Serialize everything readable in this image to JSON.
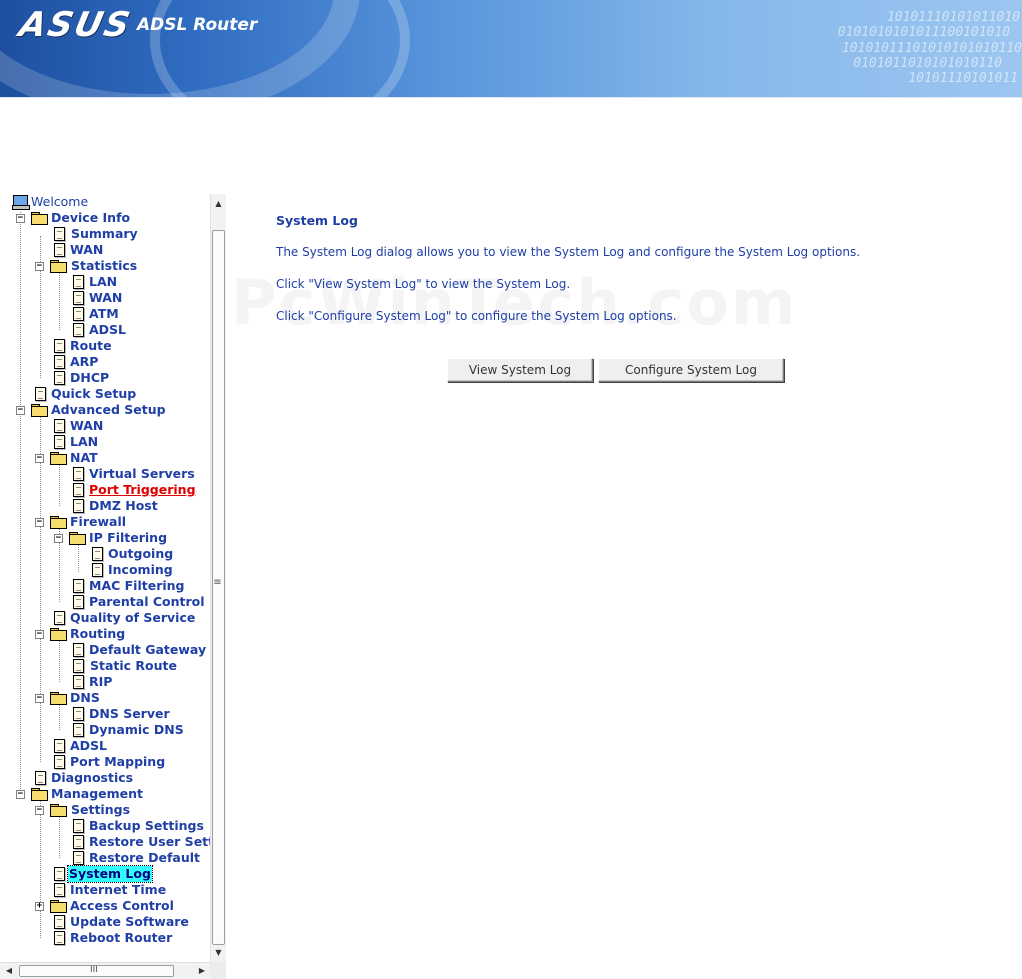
{
  "header": {
    "logo_text": "ASUS",
    "product_title": "ADSL Router",
    "binary_rows": [
      "10101110101011010",
      "0101010101011100101010",
      "10101011101010101010110",
      "0101011010101010110",
      "10101110101011"
    ]
  },
  "tree": {
    "root": "Welcome",
    "device_info": "Device Info",
    "summary": "Summary",
    "wan": "WAN",
    "statistics": "Statistics",
    "stat_lan": "LAN",
    "stat_wan": "WAN",
    "stat_atm": "ATM",
    "stat_adsl": "ADSL",
    "route": "Route",
    "arp": "ARP",
    "dhcp": "DHCP",
    "quick_setup": "Quick Setup",
    "advanced_setup": "Advanced Setup",
    "adv_wan": "WAN",
    "adv_lan": "LAN",
    "nat": "NAT",
    "virtual_servers": "Virtual Servers",
    "port_triggering": "Port Triggering",
    "dmz_host": "DMZ Host",
    "firewall": "Firewall",
    "ip_filtering": "IP Filtering",
    "outgoing": "Outgoing",
    "incoming": "Incoming",
    "mac_filtering": "MAC Filtering",
    "parental_control": "Parental Control",
    "qos": "Quality of Service",
    "routing": "Routing",
    "default_gateway": "Default Gateway",
    "static_route": "Static Route",
    "rip": "RIP",
    "dns": "DNS",
    "dns_server": "DNS Server",
    "dynamic_dns": "Dynamic DNS",
    "adv_adsl": "ADSL",
    "port_mapping": "Port Mapping",
    "diagnostics": "Diagnostics",
    "management": "Management",
    "settings": "Settings",
    "backup_settings": "Backup Settings",
    "restore_user_settings": "Restore User Settin",
    "restore_default": "Restore Default",
    "system_log": "System Log",
    "internet_time": "Internet Time",
    "access_control": "Access Control",
    "update_software": "Update Software",
    "reboot_router": "Reboot Router"
  },
  "scroll": {
    "v_grip": "≡",
    "h_grip": "III"
  },
  "main": {
    "watermark": "PcWinTech.com",
    "title": "System Log",
    "description": "The System Log dialog allows you to view the System Log and configure the System Log options.",
    "view_hint": "Click \"View System Log\" to view the System Log.",
    "configure_hint": "Click \"Configure System Log\" to configure the System Log options.",
    "view_button": "View System Log",
    "configure_button": "Configure System Log"
  },
  "colors": {
    "link": "#1f3fa6",
    "active_link": "#e00000",
    "selected_bg": "#33ffff"
  }
}
